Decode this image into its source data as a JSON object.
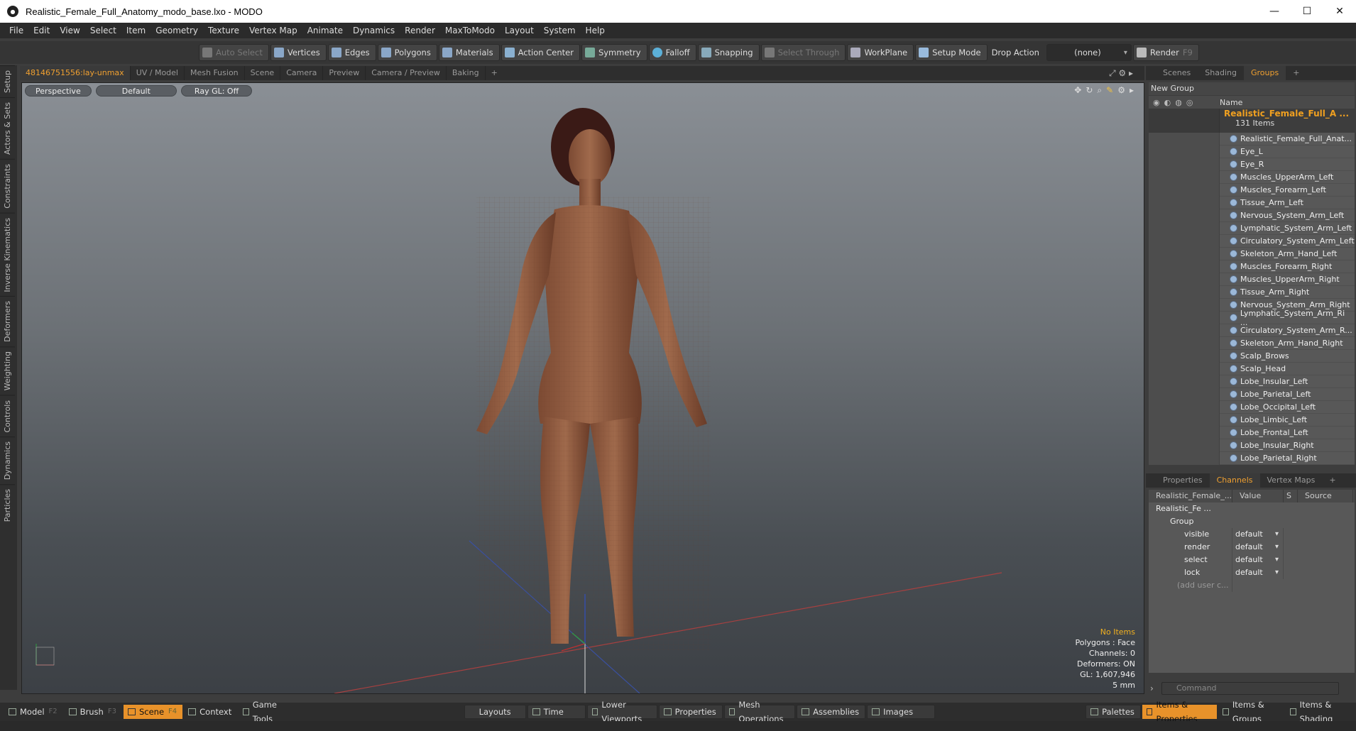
{
  "window": {
    "title": "Realistic_Female_Full_Anatomy_modo_base.lxo - MODO",
    "app_icon": "modo-icon",
    "controls": [
      "—",
      "☐",
      "✕"
    ]
  },
  "menu": [
    "File",
    "Edit",
    "View",
    "Select",
    "Item",
    "Geometry",
    "Texture",
    "Vertex Map",
    "Animate",
    "Dynamics",
    "Render",
    "MaxToModo",
    "Layout",
    "System",
    "Help"
  ],
  "toolbar": {
    "auto_select": "Auto Select",
    "vertices": "Vertices",
    "edges": "Edges",
    "polygons": "Polygons",
    "materials": "Materials",
    "action_center": "Action Center",
    "symmetry": "Symmetry",
    "falloff": "Falloff",
    "snapping": "Snapping",
    "select_through": "Select Through",
    "workplane": "WorkPlane",
    "setup_mode": "Setup Mode",
    "drop_action": "Drop Action",
    "drop_action_value": "(none)",
    "render": "Render",
    "render_key": "F9"
  },
  "left_tabs": [
    "Setup",
    "Actors & Sets",
    "Constraints",
    "Inverse Kinematics",
    "Deformers",
    "Weighting",
    "Controls",
    "Dynamics",
    "Particles"
  ],
  "viewport_tabs": [
    "48146751556:lay-unmax",
    "UV / Model",
    "Mesh Fusion",
    "Scene",
    "Camera",
    "Preview",
    "Camera / Preview",
    "Baking",
    "+"
  ],
  "viewport": {
    "view": "Perspective",
    "shading": "Default",
    "raygl": "Ray GL: Off",
    "info": {
      "items": "No Items",
      "polygons": "Polygons : Face",
      "channels": "Channels: 0",
      "deformers": "Deformers: ON",
      "gl": "GL: 1,607,946",
      "unit": "5 mm"
    }
  },
  "right_tabs": [
    "Scenes",
    "Shading",
    "Groups",
    "+"
  ],
  "groups": {
    "new_group": "New Group",
    "name_header": "Name",
    "group_name": "Realistic_Female_Full_A ...",
    "group_count": "131 Items",
    "items": [
      "Realistic_Female_Full_Anat...",
      "Eye_L",
      "Eye_R",
      "Muscles_UpperArm_Left",
      "Muscles_Forearm_Left",
      "Tissue_Arm_Left",
      "Nervous_System_Arm_Left",
      "Lymphatic_System_Arm_Left",
      "Circulatory_System_Arm_Left",
      "Skeleton_Arm_Hand_Left",
      "Muscles_Forearm_Right",
      "Muscles_UpperArm_Right",
      "Tissue_Arm_Right",
      "Nervous_System_Arm_Right",
      "Lymphatic_System_Arm_Ri ...",
      "Circulatory_System_Arm_R...",
      "Skeleton_Arm_Hand_Right",
      "Scalp_Brows",
      "Scalp_Head",
      "Lobe_Insular_Left",
      "Lobe_Parietal_Left",
      "Lobe_Occipital_Left",
      "Lobe_Limbic_Left",
      "Lobe_Frontal_Left",
      "Lobe_Insular_Right",
      "Lobe_Parietal_Right"
    ]
  },
  "prop_tabs": [
    "Properties",
    "Channels",
    "Vertex Maps",
    "+"
  ],
  "channels": {
    "headers": [
      "Realistic_Female_...",
      "Value",
      "S",
      "Source"
    ],
    "root": "Realistic_Fe ...",
    "group": "Group",
    "rows": [
      {
        "name": "visible",
        "value": "default"
      },
      {
        "name": "render",
        "value": "default"
      },
      {
        "name": "select",
        "value": "default"
      },
      {
        "name": "lock",
        "value": "default"
      }
    ],
    "add_user": "(add user c..."
  },
  "command_placeholder": "Command",
  "bottom": {
    "left": [
      {
        "label": "Model",
        "key": "F2"
      },
      {
        "label": "Brush",
        "key": "F3"
      },
      {
        "label": "Scene",
        "key": "F4"
      },
      {
        "label": "Context",
        "key": ""
      },
      {
        "label": "Game Tools",
        "key": ""
      }
    ],
    "middle": [
      "Layouts",
      "Time",
      "Lower Viewports",
      "Properties",
      "Mesh Operations",
      "Assemblies",
      "Images"
    ],
    "right": [
      "Palettes",
      "Items & Properties",
      "Items & Groups",
      "Items & Shading"
    ]
  },
  "accent_color": "#e8922a"
}
